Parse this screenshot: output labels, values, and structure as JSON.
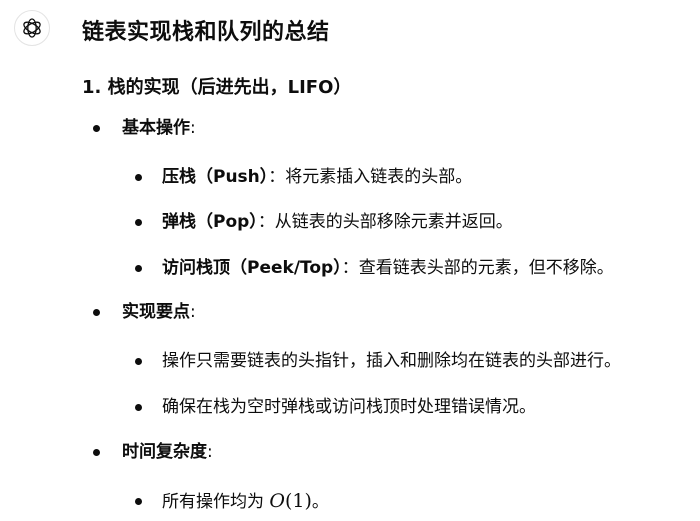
{
  "title": "链表实现栈和队列的总结",
  "section": {
    "title": "1. 栈的实现（后进先出，LIFO）"
  },
  "basic_ops": {
    "label": "基本操作",
    "colon": ":",
    "items": [
      {
        "term": "压栈（Push）",
        "desc": "：将元素插入链表的头部。"
      },
      {
        "term": "弹栈（Pop）",
        "desc": "：从链表的头部移除元素并返回。"
      },
      {
        "term": "访问栈顶（Peek/Top）",
        "desc": "：查看链表头部的元素，但不移除。"
      }
    ]
  },
  "key_points": {
    "label": "实现要点",
    "colon": ":",
    "items": [
      "操作只需要链表的头指针，插入和删除均在链表的头部进行。",
      "确保在栈为空时弹栈或访问栈顶时处理错误情况。"
    ]
  },
  "complexity": {
    "label": "时间复杂度",
    "colon": ":",
    "item_prefix": "所有操作均为 ",
    "math_o": "O",
    "math_open": "(",
    "math_one": "1",
    "math_close": ")",
    "item_suffix": "。"
  }
}
